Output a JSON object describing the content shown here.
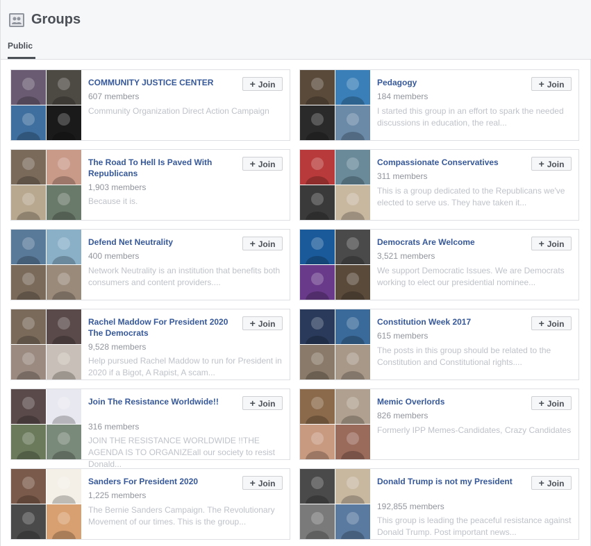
{
  "header": {
    "title": "Groups",
    "tab": "Public"
  },
  "join_label": "Join",
  "groups": [
    {
      "name": "COMMUNITY JUSTICE CENTER",
      "members": "607 members",
      "description": "Community Organization Direct Action Campaign",
      "thumbs": [
        "#6a5a72",
        "#4d4a44",
        "#3f6f9e",
        "#1a1a1a"
      ]
    },
    {
      "name": "Pedagogy",
      "members": "184 members",
      "description": "I started this group in an effort to spark the needed discussions in education, the real...",
      "thumbs": [
        "#5a4a3a",
        "#3a7fb8",
        "#2a2a2a",
        "#6a8aa8"
      ]
    },
    {
      "name": "The Road To Hell Is Paved With Republicans",
      "members": "1,903 members",
      "description": "Because it is.",
      "thumbs": [
        "#7a6a5a",
        "#c99a88",
        "#b8a890",
        "#6a7a6a"
      ]
    },
    {
      "name": "Compassionate Conservatives",
      "members": "311 members",
      "description": "This is a group dedicated to the Republicans we've elected to serve us. They have taken it...",
      "thumbs": [
        "#b83a3a",
        "#6a8a9a",
        "#3a3a3a",
        "#c8b8a0"
      ]
    },
    {
      "name": "Defend Net Neutrality",
      "members": "400 members",
      "description": "Network Neutrality is an institution that benefits both consumers and content providers....",
      "thumbs": [
        "#5a7a9a",
        "#8ab0c8",
        "#7a6a5a",
        "#9a8a7a"
      ]
    },
    {
      "name": "Democrats Are Welcome",
      "members": "3,521 members",
      "description": "We support Democratic Issues. We are Democrats working to elect our presidential nominee...",
      "thumbs": [
        "#1a5a9a",
        "#4a4a4a",
        "#6a3a8a",
        "#5a4a3a"
      ]
    },
    {
      "name": "Rachel Maddow For President 2020 The Democrats",
      "members": "9,528 members",
      "description": "Help pursued Rachel Maddow to run for President in 2020 if a Bigot, A Rapist, A scam...",
      "thumbs": [
        "#7a6a5a",
        "#5a4a4a",
        "#9a8a80",
        "#c8c0b8"
      ]
    },
    {
      "name": "Constitution Week 2017",
      "members": "615 members",
      "description": "The posts in this group should be related to the Constitution and Constitutional rights....",
      "thumbs": [
        "#2a3a5a",
        "#3a6a9a",
        "#8a7a6a",
        "#a89888"
      ]
    },
    {
      "name": "Join The Resistance Worldwide!!",
      "members": "316 members",
      "description": "JOIN THE RESISTANCE WORLDWIDE !!THE AGENDA IS TO ORGANIZEall our society to resist Donald...",
      "thumbs": [
        "#5a4a4a",
        "#e8e8f0",
        "#6a7a5a",
        "#7a8a7a"
      ]
    },
    {
      "name": "Memic Overlords",
      "members": "826 members",
      "description": "Formerly IPP Memes-Candidates, Crazy Candidates",
      "thumbs": [
        "#8a6a4a",
        "#b0a090",
        "#c89a80",
        "#9a6a5a"
      ]
    },
    {
      "name": "Sanders For President 2020",
      "members": "1,225 members",
      "description": "The Bernie Sanders Campaign. The Revolutionary Movement of our times. This is the group...",
      "thumbs": [
        "#7a5a4a",
        "#f4f0e8",
        "#4a4a4a",
        "#d8a070"
      ]
    },
    {
      "name": "Donald Trump is not my President",
      "members": "192,855 members",
      "description": "This group is leading the peaceful resistance against Donald Trump. Post important news...",
      "thumbs": [
        "#4a4a4a",
        "#c8b8a0",
        "#7a7a7a",
        "#5a7aa0"
      ]
    }
  ]
}
